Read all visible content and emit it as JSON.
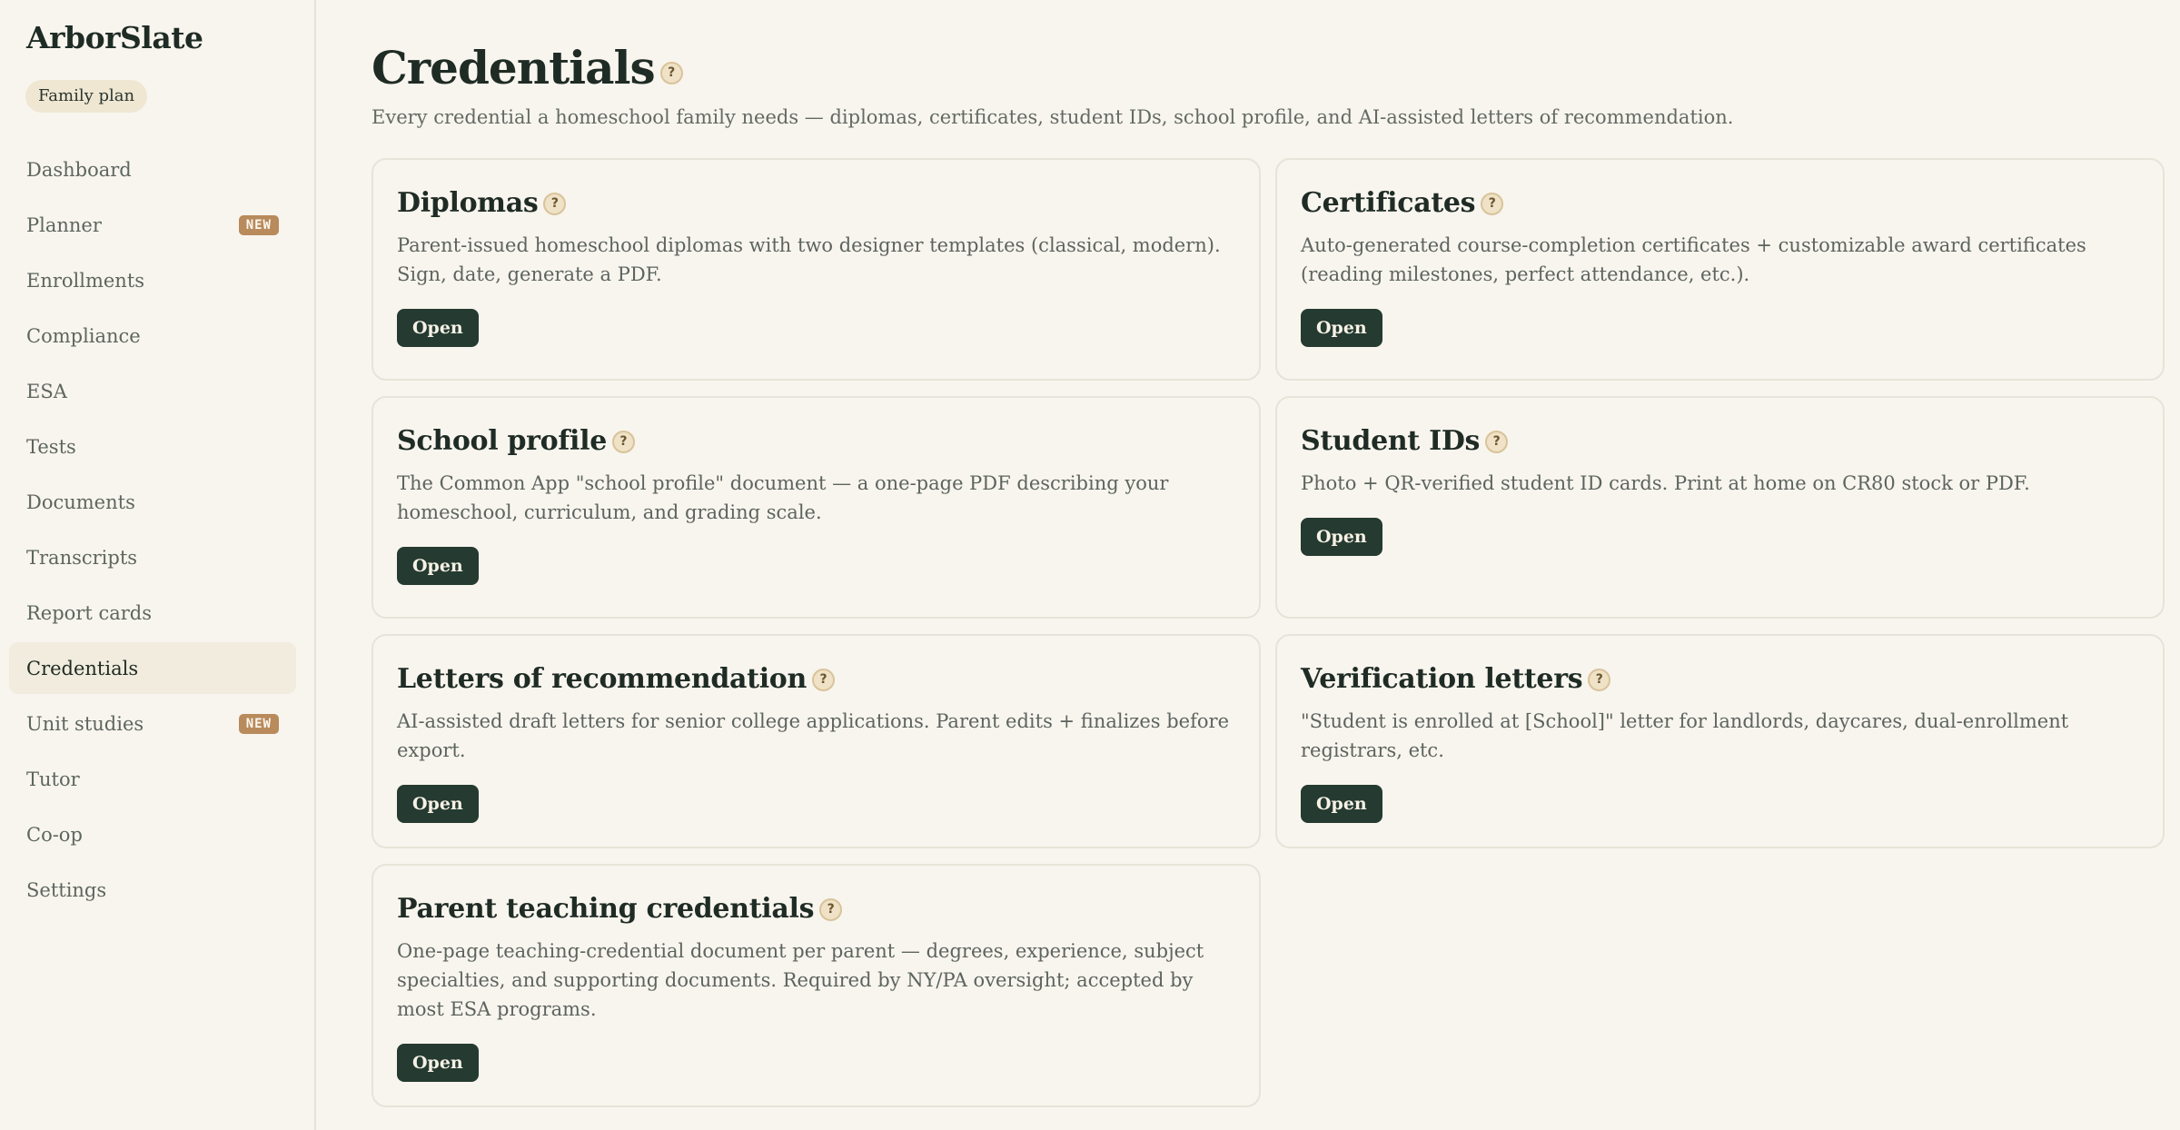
{
  "brand": "ArborSlate",
  "plan": "Family plan",
  "nav": [
    {
      "label": "Dashboard",
      "badge": ""
    },
    {
      "label": "Planner",
      "badge": "NEW"
    },
    {
      "label": "Enrollments",
      "badge": ""
    },
    {
      "label": "Compliance",
      "badge": ""
    },
    {
      "label": "ESA",
      "badge": ""
    },
    {
      "label": "Tests",
      "badge": ""
    },
    {
      "label": "Documents",
      "badge": ""
    },
    {
      "label": "Transcripts",
      "badge": ""
    },
    {
      "label": "Report cards",
      "badge": ""
    },
    {
      "label": "Credentials",
      "badge": ""
    },
    {
      "label": "Unit studies",
      "badge": "NEW"
    },
    {
      "label": "Tutor",
      "badge": ""
    },
    {
      "label": "Co-op",
      "badge": ""
    },
    {
      "label": "Settings",
      "badge": ""
    }
  ],
  "page": {
    "title": "Credentials",
    "subtitle": "Every credential a homeschool family needs — diplomas, certificates, student IDs, school profile, and AI-assisted letters of recommendation."
  },
  "help_glyph": "?",
  "open_label": "Open",
  "cards": [
    {
      "title": "Diplomas",
      "desc": "Parent-issued homeschool diplomas with two designer templates (classical, modern). Sign, date, generate a PDF."
    },
    {
      "title": "Certificates",
      "desc": "Auto-generated course-completion certificates + customizable award certificates (reading milestones, perfect attendance, etc.)."
    },
    {
      "title": "School profile",
      "desc": "The Common App \"school profile\" document — a one-page PDF describing your homeschool, curriculum, and grading scale."
    },
    {
      "title": "Student IDs",
      "desc": "Photo + QR-verified student ID cards. Print at home on CR80 stock or PDF."
    },
    {
      "title": "Letters of recommendation",
      "desc": "AI-assisted draft letters for senior college applications. Parent edits + finalizes before export."
    },
    {
      "title": "Verification letters",
      "desc": "\"Student is enrolled at [School]\" letter for landlords, daycares, dual-enrollment registrars, etc."
    },
    {
      "title": "Parent teaching credentials",
      "desc": "One-page teaching-credential document per parent — degrees, experience, subject specialties, and supporting documents. Required by NY/PA oversight; accepted by most ESA programs."
    }
  ]
}
